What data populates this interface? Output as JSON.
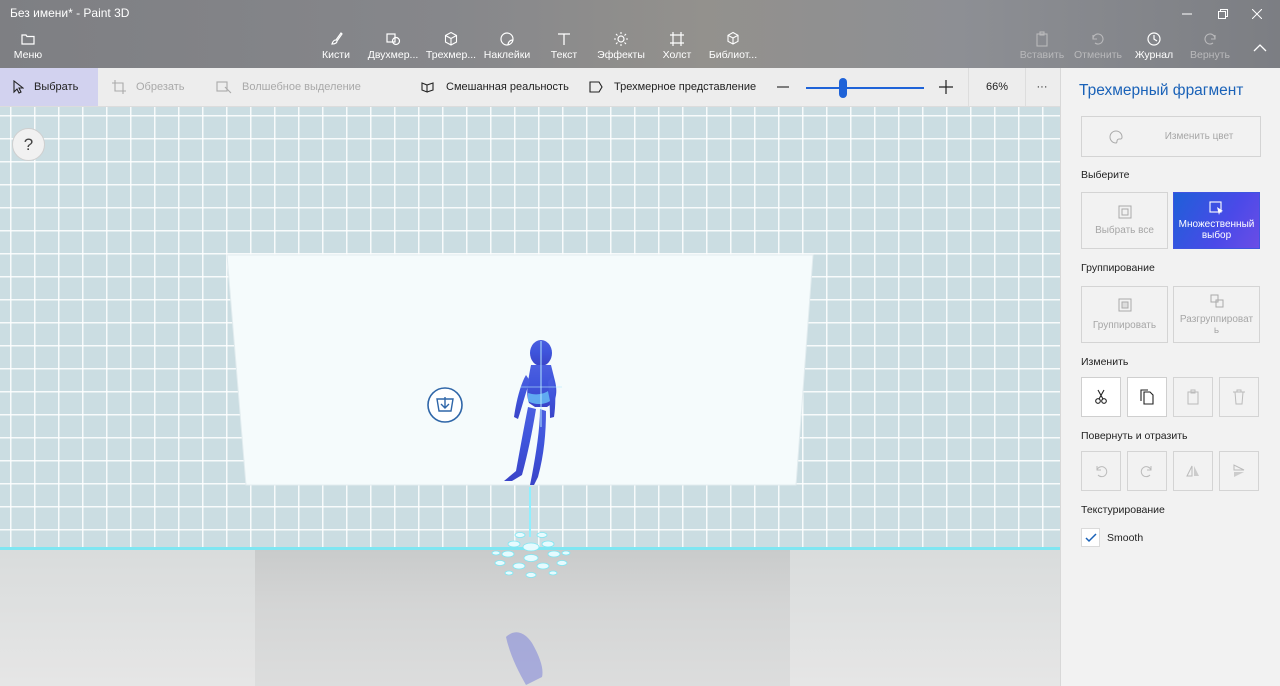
{
  "window": {
    "title": "Без имени* - Paint 3D"
  },
  "ribbon": {
    "menu": "Меню",
    "tools": [
      {
        "label": "Кисти",
        "icon": "brush-icon"
      },
      {
        "label": "Двухмер...",
        "icon": "2d-shapes-icon"
      },
      {
        "label": "Трехмер...",
        "icon": "3d-shapes-icon"
      },
      {
        "label": "Наклейки",
        "icon": "stickers-icon"
      },
      {
        "label": "Текст",
        "icon": "text-icon"
      },
      {
        "label": "Эффекты",
        "icon": "effects-icon"
      },
      {
        "label": "Холст",
        "icon": "canvas-icon"
      },
      {
        "label": "Библиот...",
        "icon": "library-icon"
      }
    ],
    "paste": "Вставить",
    "undo": "Отменить",
    "history": "Журнал",
    "redo": "Вернуть"
  },
  "toolbar": {
    "select": "Выбрать",
    "crop": "Обрезать",
    "magic_select": "Волшебное выделение",
    "mixed_reality": "Смешанная реальность",
    "view_3d": "Трехмерное представление",
    "zoom": "66%",
    "zoom_level": 0.31,
    "more": "···"
  },
  "canvas": {
    "help": "?"
  },
  "panel": {
    "title": "Трехмерный фрагмент",
    "change_color": "Изменить цвет",
    "select_label": "Выберите",
    "select_all": "Выбрать все",
    "multi_select": "Множественный выбор",
    "grouping_label": "Группирование",
    "group": "Группировать",
    "ungroup": "Разгруппировать",
    "edit_label": "Изменить",
    "rotate_label": "Повернуть и отразить",
    "texture_label": "Текстурирование",
    "smooth": "Smooth",
    "smooth_checked": true
  },
  "colors": {
    "accent": "#1a62b8",
    "active_button": "#3f55e0",
    "figure": "#3a4fd4"
  }
}
